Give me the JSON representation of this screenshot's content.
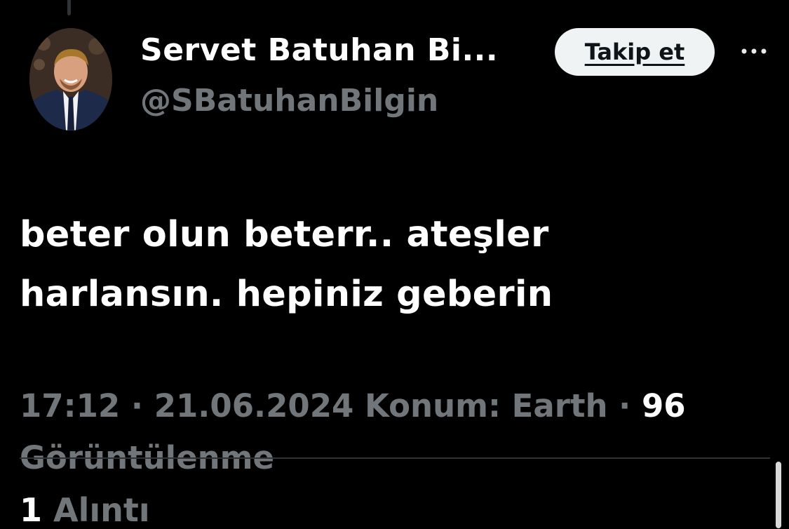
{
  "author": {
    "display_name": "Servet Batuhan Bi...",
    "handle": "@SBatuhanBilgin"
  },
  "follow_button": {
    "label": "Takip et"
  },
  "more_icon": "more-horizontal-icon",
  "tweet": {
    "text_lines": [
      "beter olun beterr.. ateşler",
      "harlansın. hepiniz geberin"
    ]
  },
  "meta": {
    "time": "17:12",
    "separator": " · ",
    "date": "21.06.2024",
    "location": "Konum: Earth",
    "views_count": "96",
    "views_label": "Görüntülenme"
  },
  "stats": {
    "quote_count": "1",
    "quote_label": "Alıntı"
  },
  "colors": {
    "background": "#000000",
    "primary_text": "#ffffff",
    "secondary_text": "#71767b",
    "button_bg": "#eff3f4",
    "divider": "#2f3336"
  }
}
